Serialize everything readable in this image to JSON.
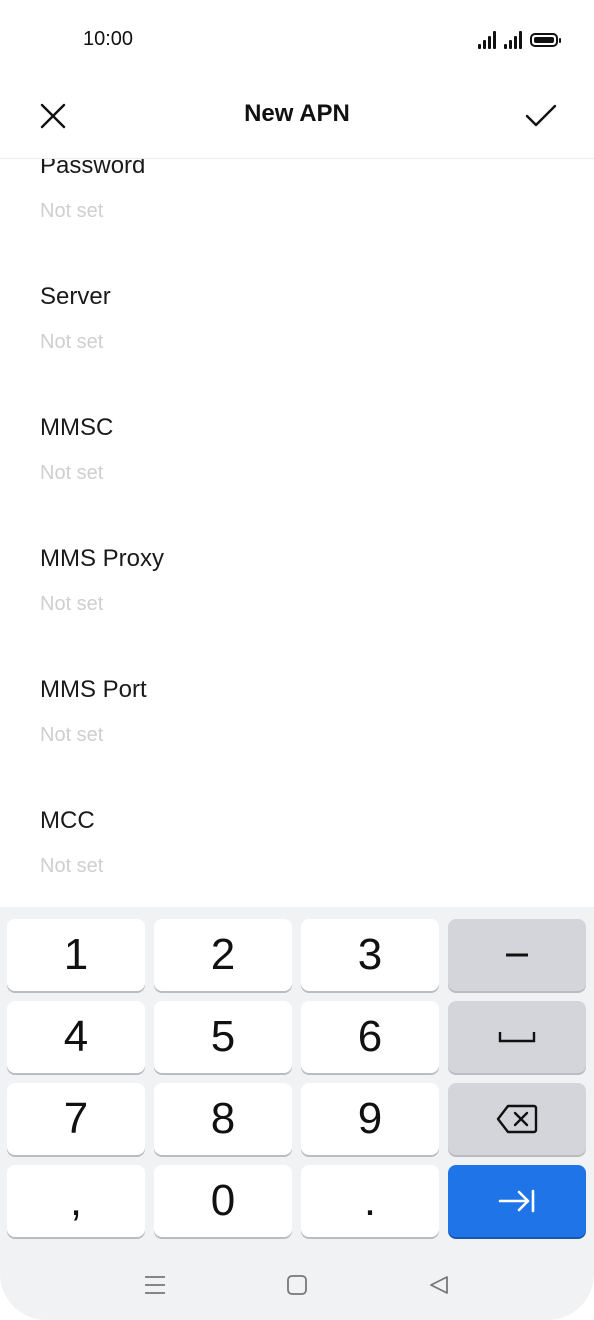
{
  "status_bar": {
    "time": "10:00"
  },
  "app_bar": {
    "title": "New APN"
  },
  "fields": [
    {
      "label": "Password",
      "value": "Not set"
    },
    {
      "label": "Server",
      "value": "Not set"
    },
    {
      "label": "MMSC",
      "value": "Not set"
    },
    {
      "label": "MMS Proxy",
      "value": "Not set"
    },
    {
      "label": "MMS Port",
      "value": "Not set"
    },
    {
      "label": "MCC",
      "value": "Not set"
    }
  ],
  "keyboard": {
    "keys": [
      "1",
      "2",
      "3",
      "4",
      "5",
      "6",
      "7",
      "8",
      "9",
      ",",
      "0",
      "."
    ],
    "function_keys": [
      "minus-icon",
      "space-icon",
      "backspace-icon",
      "tab-next-icon"
    ],
    "enter_color": "#1f75e8"
  },
  "nav_bar": {
    "buttons": [
      "menu-icon",
      "home-icon",
      "back-icon"
    ]
  }
}
